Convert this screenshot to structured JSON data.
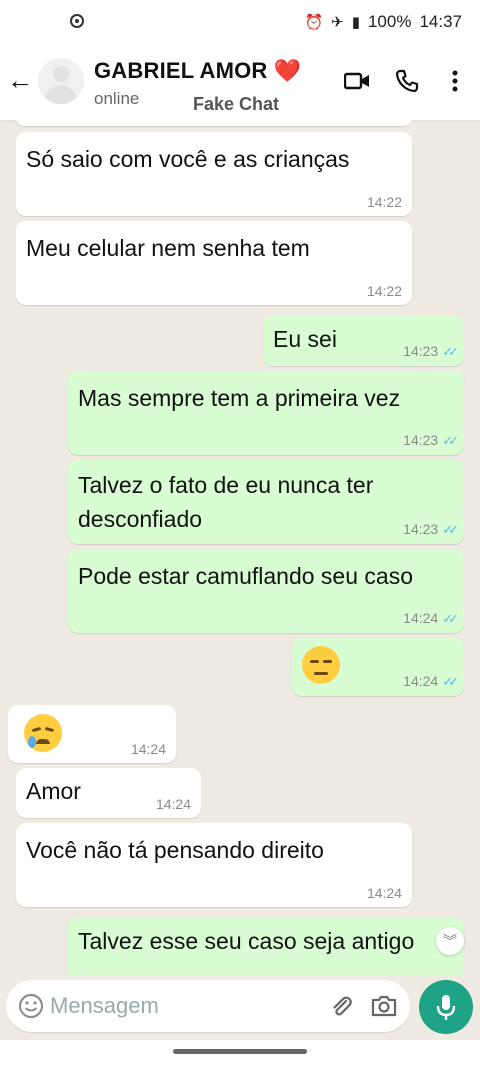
{
  "status_bar": {
    "battery": "100%",
    "time": "14:37"
  },
  "header": {
    "contact_name": "GABRIEL AMOR",
    "heart": "❤️",
    "status": "online",
    "watermark": "Fake Chat"
  },
  "messages": [
    {
      "dir": "in",
      "text": "Só saio com você e as crianças",
      "time": "14:22"
    },
    {
      "dir": "in",
      "text": "Meu celular nem senha tem",
      "time": "14:22"
    },
    {
      "dir": "out",
      "text": "Eu sei",
      "time": "14:23"
    },
    {
      "dir": "out",
      "text": "Mas sempre tem a primeira vez",
      "time": "14:23"
    },
    {
      "dir": "out",
      "text_line1": "Talvez o fato de eu nunca ter",
      "text_line2": "desconfiado",
      "time": "14:23"
    },
    {
      "dir": "out",
      "text": "Pode estar camuflando seu caso",
      "time": "14:24"
    },
    {
      "dir": "out",
      "emoji": "unamused-face",
      "time": "14:24"
    },
    {
      "dir": "in",
      "emoji": "sad-but-relieved-face",
      "time": "14:24"
    },
    {
      "dir": "in",
      "text": "Amor",
      "time": "14:24"
    },
    {
      "dir": "in",
      "text": "Você não tá pensando direito",
      "time": "14:24"
    },
    {
      "dir": "out",
      "text": "Talvez esse seu caso seja antigo"
    }
  ],
  "composer": {
    "placeholder": "Mensagem"
  },
  "colors": {
    "incoming_bubble": "#ffffff",
    "outgoing_bubble": "#d9fdd3",
    "chat_background": "#efeae2",
    "mic_button": "#1ea386",
    "read_ticks": "#53bdeb"
  }
}
